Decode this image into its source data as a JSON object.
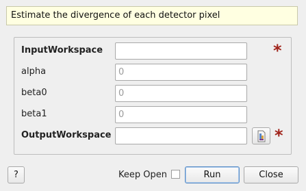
{
  "description": "Estimate the divergence of each detector pixel",
  "fields": [
    {
      "label": "InputWorkspace",
      "value": "",
      "placeholder": "",
      "mandatory": true
    },
    {
      "label": "alpha",
      "value": "",
      "placeholder": "0",
      "mandatory": false
    },
    {
      "label": "beta0",
      "value": "",
      "placeholder": "0",
      "mandatory": false
    },
    {
      "label": "beta1",
      "value": "",
      "placeholder": "0",
      "mandatory": false
    },
    {
      "label": "OutputWorkspace",
      "value": "",
      "placeholder": "",
      "mandatory": true
    }
  ],
  "mandatory_marker": "*",
  "colors": {
    "mandatory": "#a0231a",
    "description_bg": "#ffffe1"
  },
  "footer": {
    "help_label": "?",
    "keep_open_label": "Keep Open",
    "keep_open_checked": false,
    "run_label": "Run",
    "close_label": "Close"
  }
}
